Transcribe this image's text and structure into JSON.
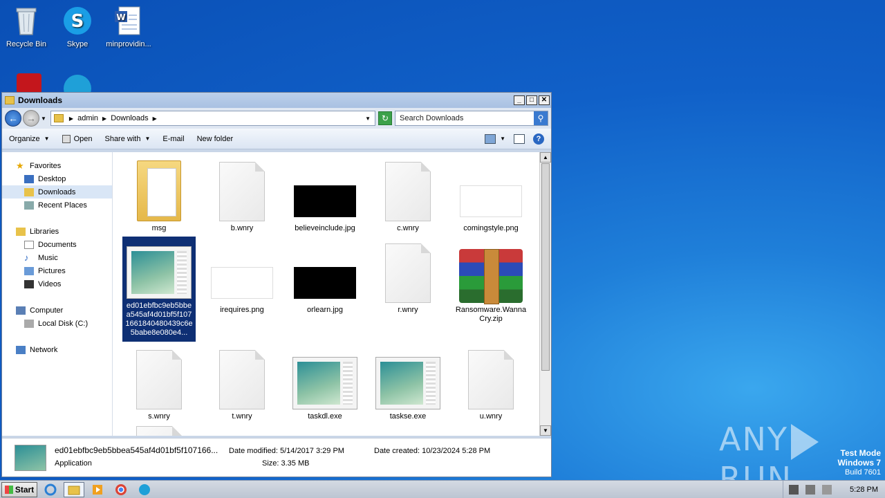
{
  "desktop": {
    "icons": [
      {
        "label": "Recycle Bin"
      },
      {
        "label": "Skype"
      },
      {
        "label": "minprovidin..."
      }
    ]
  },
  "watermark": {
    "text_left": "ANY",
    "text_right": "RUN"
  },
  "system_note": {
    "line1": "Test Mode",
    "line2": "Windows 7",
    "line3": "Build 7601"
  },
  "window": {
    "title": "Downloads",
    "address": {
      "crumbs": [
        "admin",
        "Downloads"
      ]
    },
    "search_placeholder": "Search Downloads",
    "toolbar": {
      "organize": "Organize",
      "open": "Open",
      "share_with": "Share with",
      "email": "E-mail",
      "new_folder": "New folder"
    },
    "nav": {
      "favorites": "Favorites",
      "desktop": "Desktop",
      "downloads": "Downloads",
      "recent": "Recent Places",
      "libraries": "Libraries",
      "documents": "Documents",
      "music": "Music",
      "pictures": "Pictures",
      "videos": "Videos",
      "computer": "Computer",
      "localdisk": "Local Disk (C:)",
      "network": "Network"
    },
    "files": [
      {
        "name": "msg"
      },
      {
        "name": "b.wnry"
      },
      {
        "name": "believeinclude.jpg"
      },
      {
        "name": "c.wnry"
      },
      {
        "name": "comingstyle.png"
      },
      {
        "name": "ed01ebfbc9eb5bbea545af4d01bf5f1071661840480439c6e5babe8e080e4..."
      },
      {
        "name": "irequires.png"
      },
      {
        "name": "orlearn.jpg"
      },
      {
        "name": "r.wnry"
      },
      {
        "name": "Ransomware.WannaCry.zip"
      },
      {
        "name": "s.wnry"
      },
      {
        "name": "t.wnry"
      },
      {
        "name": "taskdl.exe"
      },
      {
        "name": "taskse.exe"
      },
      {
        "name": "u.wnry"
      }
    ],
    "details": {
      "filename": "ed01ebfbc9eb5bbea545af4d01bf5f107166...",
      "type": "Application",
      "date_modified": "Date modified: 5/14/2017 3:29 PM",
      "size": "Size: 3.35 MB",
      "date_created": "Date created: 10/23/2024 5:28 PM"
    }
  },
  "taskbar": {
    "start": "Start",
    "clock": "5:28 PM"
  }
}
